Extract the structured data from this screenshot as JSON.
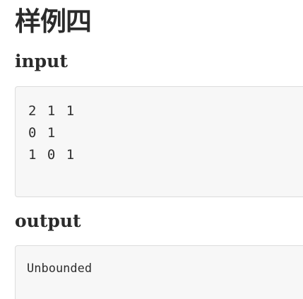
{
  "title": "样例四",
  "input": {
    "heading": "input",
    "lines": [
      "2 1 1",
      "0 1",
      "1 0 1"
    ]
  },
  "output": {
    "heading": "output",
    "text": "Unbounded"
  }
}
